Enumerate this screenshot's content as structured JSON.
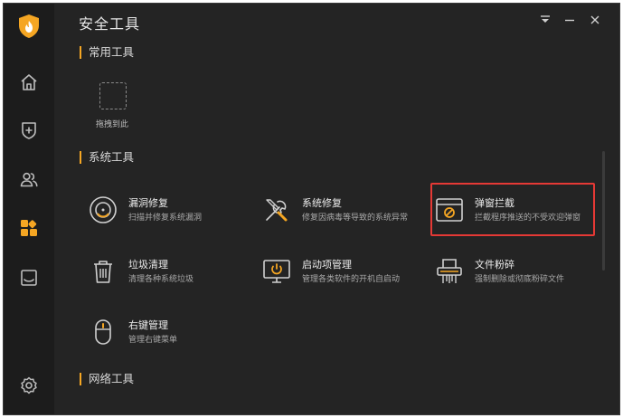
{
  "window": {
    "title": "安全工具"
  },
  "colors": {
    "accent": "#f5a623",
    "highlight": "#e53935",
    "background": "#242424",
    "sidebar": "#1c1c1c"
  },
  "sidebar": {
    "items": [
      {
        "icon": "home-icon"
      },
      {
        "icon": "shield-plus-icon"
      },
      {
        "icon": "users-icon"
      },
      {
        "icon": "grid-apps-icon",
        "active": true
      },
      {
        "icon": "inbox-icon"
      },
      {
        "icon": "gear-icon"
      }
    ]
  },
  "sections": {
    "common": {
      "title": "常用工具",
      "drop_label": "拖拽到此"
    },
    "system": {
      "title": "系统工具"
    },
    "network": {
      "title": "网络工具"
    }
  },
  "tools": [
    {
      "icon": "bug-fix-icon",
      "name": "漏洞修复",
      "desc": "扫描并修复系统漏洞"
    },
    {
      "icon": "wrench-screwdriver-icon",
      "name": "系统修复",
      "desc": "修复因病毒等导致的系统异常"
    },
    {
      "icon": "popup-block-icon",
      "name": "弹窗拦截",
      "desc": "拦截程序推送的不受欢迎弹窗",
      "highlighted": true
    },
    {
      "icon": "trash-icon",
      "name": "垃圾清理",
      "desc": "清理各种系统垃圾"
    },
    {
      "icon": "startup-monitor-icon",
      "name": "启动项管理",
      "desc": "管理各类软件的开机自启动"
    },
    {
      "icon": "shredder-icon",
      "name": "文件粉碎",
      "desc": "强制删除或彻底粉碎文件"
    },
    {
      "icon": "mouse-icon",
      "name": "右键管理",
      "desc": "管理右键菜单"
    }
  ]
}
